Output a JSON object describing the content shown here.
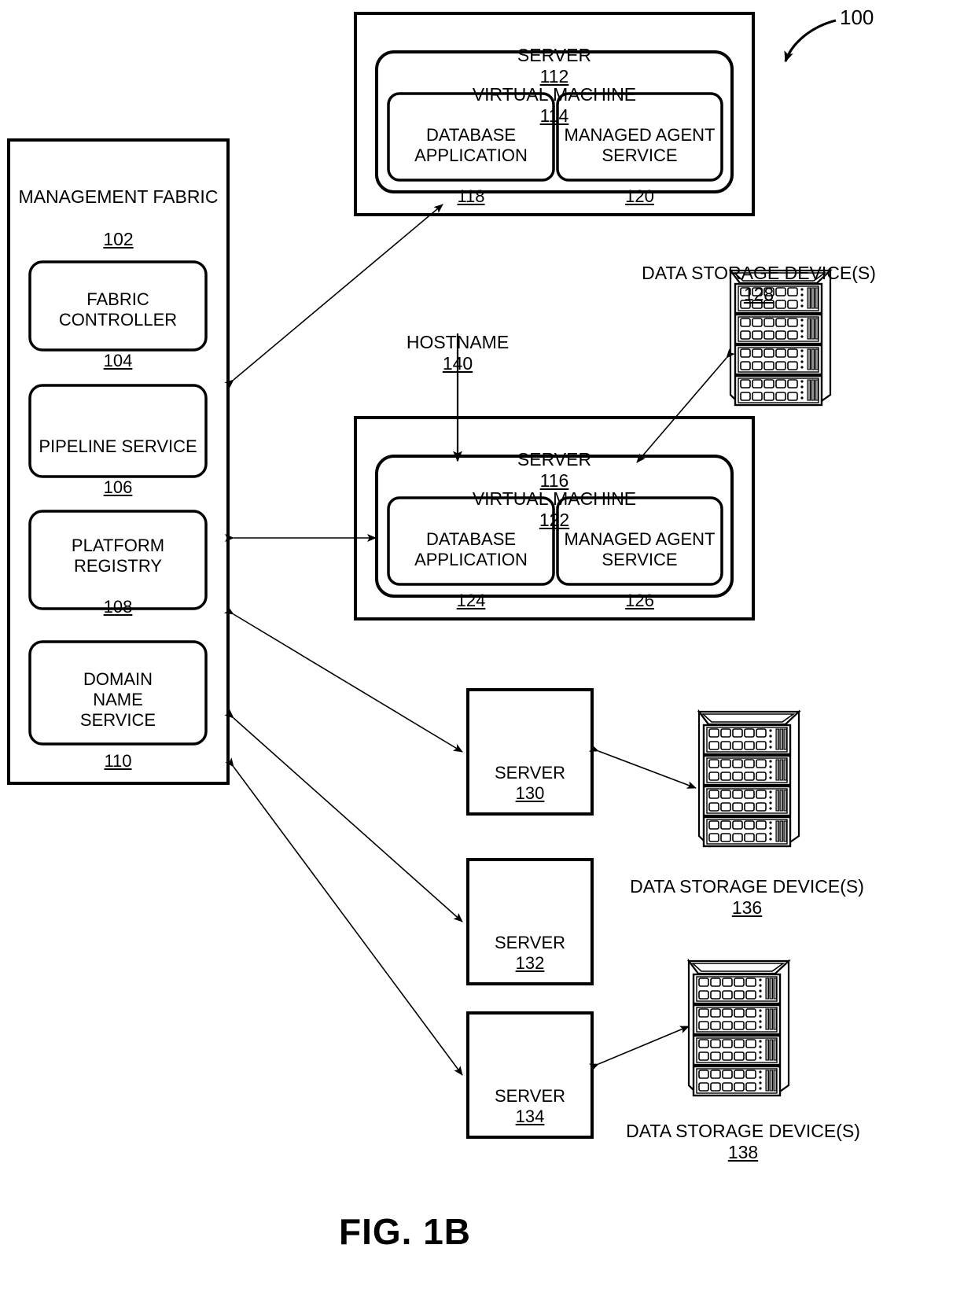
{
  "figure": {
    "title": "FIG. 1B",
    "system_ref": "100"
  },
  "management_fabric": {
    "title": "MANAGEMENT FABRIC",
    "ref": "102",
    "components": [
      {
        "name": "FABRIC\nCONTROLLER",
        "ref": "104"
      },
      {
        "name": "PIPELINE SERVICE",
        "ref": "106"
      },
      {
        "name": "PLATFORM\nREGISTRY",
        "ref": "108"
      },
      {
        "name": "DOMAIN\nNAME\nSERVICE",
        "ref": "110"
      }
    ]
  },
  "servers": {
    "server_112": {
      "title": "SERVER",
      "ref": "112",
      "vm": {
        "title": "VIRTUAL MACHINE",
        "ref": "114",
        "apps": [
          {
            "name": "DATABASE\nAPPLICATION",
            "ref": "118"
          },
          {
            "name": "MANAGED AGENT\nSERVICE",
            "ref": "120"
          }
        ]
      }
    },
    "server_116": {
      "title": "SERVER",
      "ref": "116",
      "vm": {
        "title": "VIRTUAL MACHINE",
        "ref": "122",
        "apps": [
          {
            "name": "DATABASE\nAPPLICATION",
            "ref": "124"
          },
          {
            "name": "MANAGED AGENT\nSERVICE",
            "ref": "126"
          }
        ]
      }
    },
    "plain": [
      {
        "title": "SERVER",
        "ref": "130"
      },
      {
        "title": "SERVER",
        "ref": "132"
      },
      {
        "title": "SERVER",
        "ref": "134"
      }
    ]
  },
  "hostname": {
    "label": "HOSTNAME",
    "ref": "140"
  },
  "storage_devices": [
    {
      "label": "DATA STORAGE DEVICE(S)",
      "ref": "128"
    },
    {
      "label": "DATA STORAGE DEVICE(S)",
      "ref": "136"
    },
    {
      "label": "DATA STORAGE DEVICE(S)",
      "ref": "138"
    }
  ],
  "colors": {
    "stroke": "#000000",
    "background": "#ffffff",
    "icon_shadow": "#808080"
  }
}
